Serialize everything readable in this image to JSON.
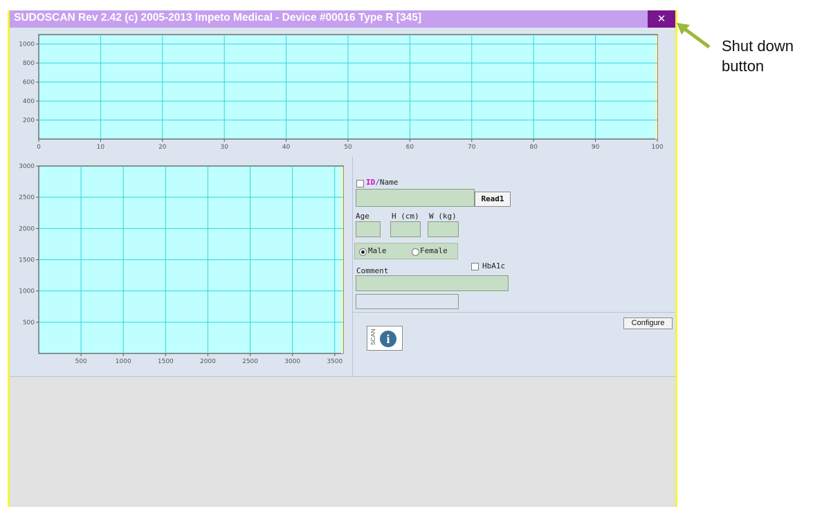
{
  "window": {
    "title": "SUDOSCAN Rev 2.42 (c) 2005-2013 Impeto Medical - Device #00016 Type R [345]",
    "close_glyph": "✕"
  },
  "chart_data": [
    {
      "type": "line",
      "xlim": [
        0,
        100
      ],
      "ylim": [
        0,
        1100
      ],
      "x_ticks": [
        0,
        10,
        20,
        30,
        40,
        50,
        60,
        70,
        80,
        90,
        100
      ],
      "y_ticks": [
        200,
        400,
        600,
        800,
        1000
      ],
      "series": [],
      "grid": true,
      "plot_bg": "#c0ffff",
      "grid_color": "#2fd5dd"
    },
    {
      "type": "line",
      "xlim": [
        0,
        3600
      ],
      "ylim": [
        0,
        3000
      ],
      "x_ticks": [
        500,
        1000,
        1500,
        2000,
        2500,
        3000,
        3500
      ],
      "y_ticks": [
        500,
        1000,
        1500,
        2000,
        2500,
        3000
      ],
      "series": [],
      "grid": true,
      "plot_bg": "#c0ffff",
      "grid_color": "#2fd5dd"
    }
  ],
  "form": {
    "id_label": "ID",
    "id_sep": "/",
    "name_label": "Name",
    "read_button": "Read1",
    "age_label": "Age",
    "height_label": "H (cm)",
    "weight_label": "W (kg)",
    "male_label": "Male",
    "female_label": "Female",
    "gender_selected": "Male",
    "comment_label": "Comment",
    "hba1c_label": "HbA1c",
    "name_value": "",
    "age_value": "",
    "height_value": "",
    "weight_value": "",
    "comment_value": "",
    "extra_value": ""
  },
  "actions": {
    "configure_button": "Configure",
    "scan_label": "SCAN",
    "info_glyph": "i"
  },
  "annotation": {
    "text": "Shut down button"
  },
  "colors": {
    "title_bar": "#c6a0ee",
    "close_button": "#7a1590",
    "window_border": "#f5f53a",
    "arrow": "#9ab83a",
    "id_accent": "#d60ac8"
  }
}
